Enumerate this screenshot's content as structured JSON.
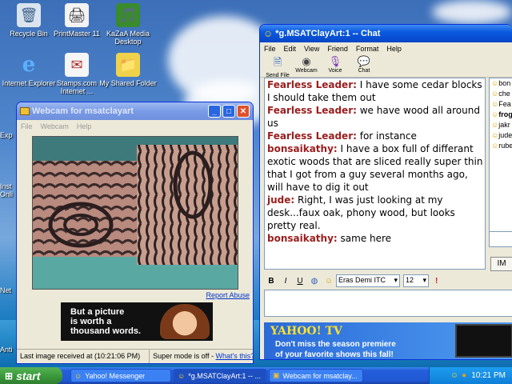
{
  "desktop": {
    "icons": [
      {
        "label": "Recycle Bin",
        "glyph": "🗑"
      },
      {
        "label": "PrintMaster 11",
        "glyph": "🖨"
      },
      {
        "label": "KaZaA Media Desktop",
        "glyph": "🎵"
      },
      {
        "label": "Internet Explorer",
        "glyph": "e"
      },
      {
        "label": "Stamps.com Internet ...",
        "glyph": "✉"
      },
      {
        "label": "My Shared Folder",
        "glyph": "📁"
      }
    ],
    "edge_labels": [
      "Exp",
      "Inst",
      "Onli",
      "Net",
      "Anti"
    ]
  },
  "webcam": {
    "title": "Webcam for msatclayart",
    "menu": [
      "File",
      "Webcam",
      "Help"
    ],
    "report_abuse": "Report Abuse",
    "ad_text_line1": "But a picture",
    "ad_text_line2": "is worth a",
    "ad_text_line3": "thousand words.",
    "status_left": "Last image received at (10:21:06 PM)",
    "status_right_prefix": "Super mode is off - ",
    "status_right_link": "What's this?"
  },
  "chat": {
    "title": "*g.MSATClayArt:1 -- Chat",
    "menu": [
      "File",
      "Edit",
      "View",
      "Friend",
      "Format",
      "Help"
    ],
    "toolbar": [
      {
        "label": "Send File",
        "icon": "send-file-icon"
      },
      {
        "label": "Webcam",
        "icon": "webcam-icon"
      },
      {
        "label": "Voice",
        "icon": "voice-icon"
      },
      {
        "label": "Chat",
        "icon": "chat-icon"
      }
    ],
    "messages": [
      {
        "who": "Fearless Leader:",
        "text": " I have some cedar blocks I should take them out"
      },
      {
        "who": "Fearless Leader:",
        "text": " we have wood all around us"
      },
      {
        "who": "Fearless Leader:",
        "text": " for instance"
      },
      {
        "who": "bonsaikathy:",
        "text": " I have a box full of differant exotic woods that are sliced really super thin that I got from a guy several months ago, will have to dig it out"
      },
      {
        "who": "jude:",
        "text": " Right, I was just looking at my desk...faux oak, phony wood, but looks pretty real."
      },
      {
        "who": "bonsaikathy:",
        "text": " same here"
      }
    ],
    "users": [
      "bon",
      "che",
      "Fea",
      "frog",
      "jakr",
      "jude",
      "rube"
    ],
    "im_button": "IM",
    "format": {
      "bold": "B",
      "italic": "I",
      "underline": "U",
      "font": "Eras Demi ITC",
      "size": "12"
    },
    "input_value": "",
    "ad_brand": "YAHOO! TV",
    "ad_line1": "Don't miss the season premiere",
    "ad_line2": "of your favorite shows this fall!"
  },
  "taskbar": {
    "start": "start",
    "tasks": [
      "Yahoo! Messenger",
      "*g.MSATClayArt:1 -- ...",
      "Webcam for msatclay..."
    ],
    "clock": "10:21 PM"
  },
  "colors": {
    "accent": "#0a5adf",
    "chat_name": "#9b1d1d",
    "start_green": "#3c9a3c"
  }
}
